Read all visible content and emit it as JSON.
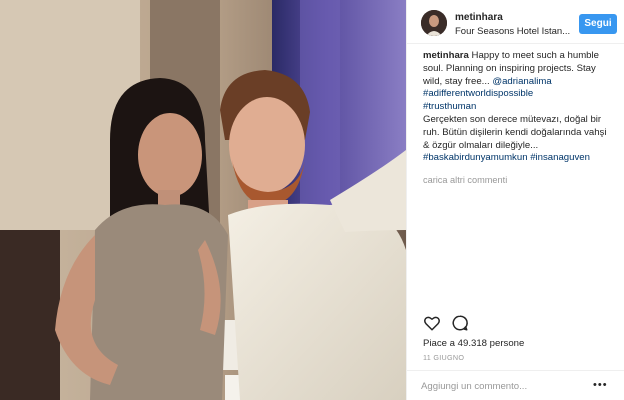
{
  "post": {
    "username": "metinhara",
    "location": "Four Seasons Hotel Istan...",
    "follow_label": "Segui"
  },
  "caption": {
    "username": "metinhara",
    "lines": [
      "Happy to meet such a humble",
      "soul. Planning on inspiring projects. Stay",
      "wild, stay free...",
      "@adrianalima",
      "#adifferentworldispossible",
      "#trusthuman",
      "Gerçekten son derece mütevazı, doğal bir",
      "ruh. Bütün dişilerin kendi doğalarında vahşi",
      "& özgür olmaları dileğiyle...",
      "#baskabirdunyamumkun #insanaguven"
    ]
  },
  "comments": {
    "load_more": "carica altri commenti"
  },
  "actions": {
    "like_icon": "heart-icon",
    "comment_icon": "comment-bubble-icon"
  },
  "stats": {
    "likes": "Piace a 49.318 persone",
    "date": "11 GIUGNO"
  },
  "comment_box": {
    "placeholder": "Aggiungi un commento...",
    "more": "•••"
  },
  "colors": {
    "accent": "#3897f0",
    "hashtag": "#003569",
    "muted": "#999999"
  }
}
